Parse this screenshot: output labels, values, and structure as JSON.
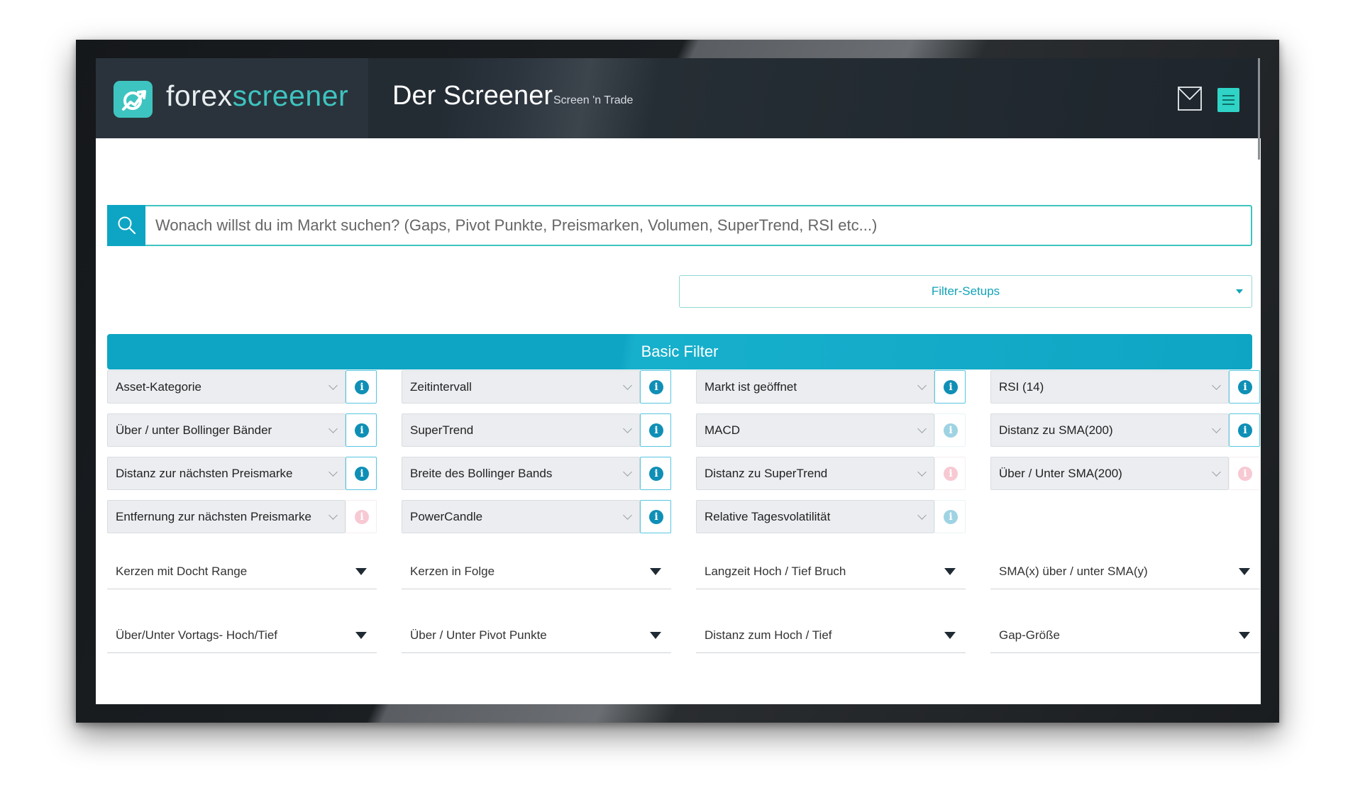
{
  "header": {
    "brand_part1": "forex",
    "brand_part2": "screener",
    "title": "Der Screener",
    "subtitle": "Screen 'n Trade"
  },
  "search": {
    "placeholder": "Wonach willst du im Markt suchen? (Gaps, Pivot Punkte, Preismarken, Volumen, SuperTrend, RSI etc...)"
  },
  "filter_setups": {
    "label": "Filter-Setups"
  },
  "basic_filter": {
    "title": "Basic Filter"
  },
  "filters": [
    {
      "label": "Asset-Kategorie",
      "info_style": "active"
    },
    {
      "label": "Zeitintervall",
      "info_style": "active"
    },
    {
      "label": "Markt ist geöffnet",
      "info_style": "active"
    },
    {
      "label": "RSI (14)",
      "info_style": "active"
    },
    {
      "label": "Über / unter Bollinger Bänder",
      "info_style": "active"
    },
    {
      "label": "SuperTrend",
      "info_style": "active"
    },
    {
      "label": "MACD",
      "info_style": "faint"
    },
    {
      "label": "Distanz zu SMA(200)",
      "info_style": "active"
    },
    {
      "label": "Distanz zur nächsten Preismarke",
      "info_style": "active"
    },
    {
      "label": "Breite des Bollinger Bands",
      "info_style": "active"
    },
    {
      "label": "Distanz zu SuperTrend",
      "info_style": "pink"
    },
    {
      "label": "Über / Unter SMA(200)",
      "info_style": "pink"
    },
    {
      "label": "Entfernung zur nächsten Preismarke",
      "info_style": "pink"
    },
    {
      "label": "PowerCandle",
      "info_style": "active"
    },
    {
      "label": "Relative Tagesvolatilität",
      "info_style": "faint"
    }
  ],
  "dropdowns": [
    "Kerzen mit Docht Range",
    "Kerzen in Folge",
    "Langzeit Hoch / Tief Bruch",
    "SMA(x) über / unter SMA(y)",
    "Über/Unter Vortags- Hoch/Tief",
    "Über / Unter Pivot Punkte",
    "Distanz zum Hoch / Tief",
    "Gap-Größe"
  ],
  "icons": {
    "logo": "chart-arrow-logo-icon",
    "mail": "mail-icon",
    "menu": "hamburger-menu-icon",
    "search": "search-icon",
    "info": "info-icon"
  },
  "colors": {
    "accent": "#0ea5c4",
    "teal": "#3ec4c0",
    "header_bg": "#232b33"
  }
}
